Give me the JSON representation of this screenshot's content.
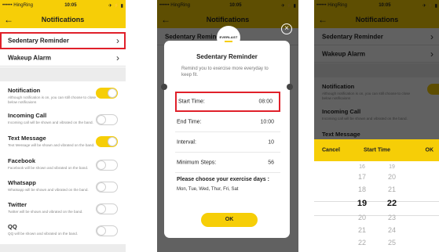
{
  "status_bar": {
    "carrier": "•••••• HingRing",
    "time": "10:05",
    "icons": "✈ ⚡ ▮"
  },
  "nav": {
    "title": "Notifications",
    "back_icon": "←"
  },
  "screen1": {
    "reminders": [
      {
        "label": "Sedentary Reminder"
      },
      {
        "label": "Wakeup Alarm"
      }
    ],
    "toggles": [
      {
        "label": "Notification",
        "desc": "Although notification is on, you can still choose to close below notificaions",
        "on": true
      },
      {
        "label": "Incoming Call",
        "desc": "Incoming call will be shown and vibrated on the band.",
        "on": false
      },
      {
        "label": "Text Message",
        "desc": "Text Message will be shown and vibrated on the band.",
        "on": true
      },
      {
        "label": "Facebook",
        "desc": "Facebook will be shown and vibrated on the band.",
        "on": false
      },
      {
        "label": "Whatsapp",
        "desc": "Whatsapp will be shown and vibrated on the band.",
        "on": false
      },
      {
        "label": "Twitter",
        "desc": "Twitter will be shown and vibrated on the band.",
        "on": false
      },
      {
        "label": "QQ",
        "desc": "QQ will be shown and vibrated on the band.",
        "on": false
      }
    ]
  },
  "screen2": {
    "logo": "EVERLAST",
    "close_icon": "×",
    "title": "Sedentary Reminder",
    "description": "Remind you to exercise more everyday to keep fit.",
    "rows": [
      {
        "key": "Start Time:",
        "value": "08:00"
      },
      {
        "key": "End Time:",
        "value": "10:00"
      },
      {
        "key": "Interval:",
        "value": "10"
      },
      {
        "key": "Minimum Steps:",
        "value": "56"
      }
    ],
    "days_heading": "Please choose your exercise days :",
    "days": "Mon,  Tue,  Wed,  Thur,  Fri,  Sat",
    "ok_label": "OK"
  },
  "screen3": {
    "cancel_label": "Cancel",
    "title": "Start Time",
    "ok_label": "OK",
    "hours": [
      "16",
      "17",
      "18",
      "19",
      "20",
      "21",
      "22"
    ],
    "minutes": [
      "19",
      "20",
      "21",
      "22",
      "23",
      "24",
      "25"
    ],
    "selected_hour": "19",
    "selected_minute": "22"
  },
  "colors": {
    "accent": "#f6ce07",
    "highlight": "#e0202a"
  }
}
